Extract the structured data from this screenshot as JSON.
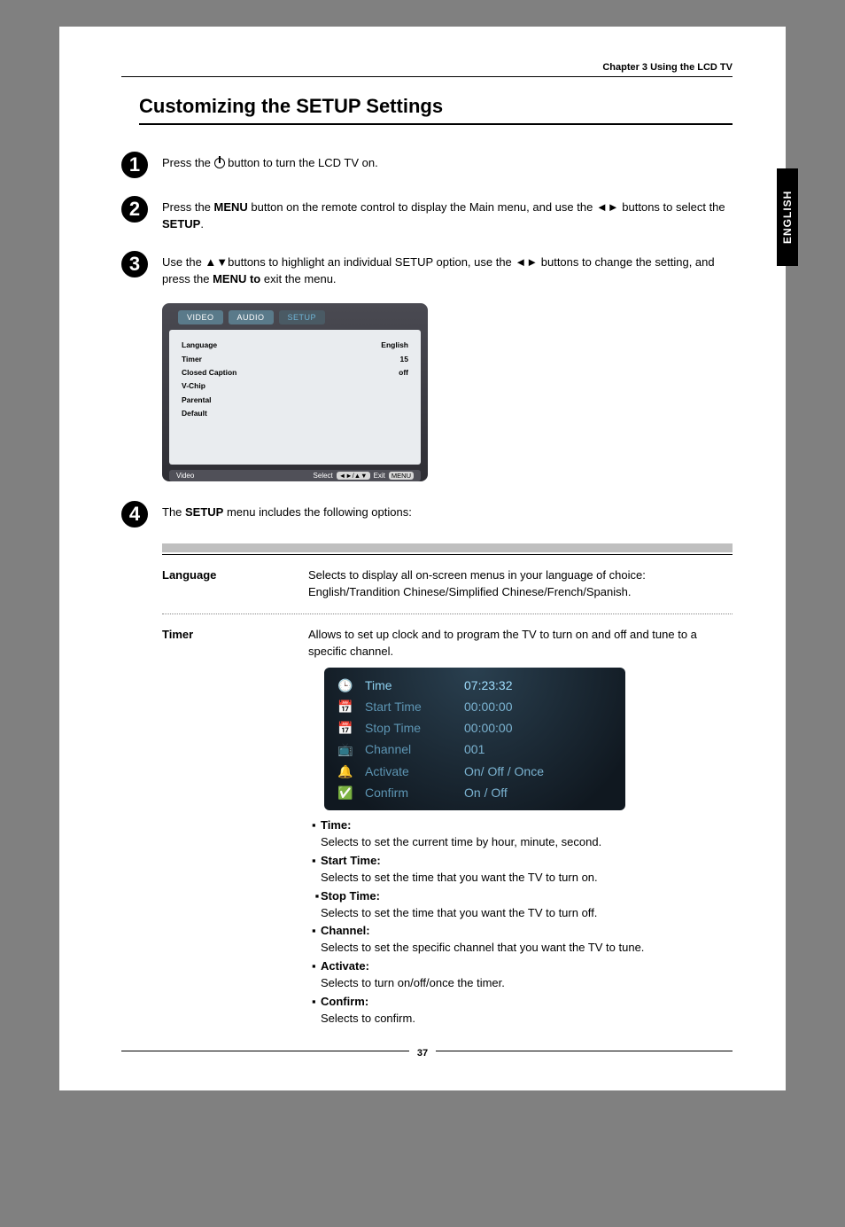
{
  "header": {
    "chapter": "Chapter 3 Using the LCD TV"
  },
  "title": "Customizing the SETUP Settings",
  "side_tab": "ENGLISH",
  "page_number": "37",
  "steps": [
    {
      "num": "1",
      "text_before": "Press the ",
      "icon": "power-icon",
      "text_after": " button to turn the LCD TV on."
    },
    {
      "num": "2",
      "text_before": "Press the ",
      "bold1": "MENU",
      "text_mid": " button on the remote control to display the Main menu, and use the ◄► buttons to select the ",
      "bold2": "SETUP",
      "text_after": "."
    },
    {
      "num": "3",
      "text_before": "Use the ▲▼buttons to highlight an individual SETUP option, use the ◄► buttons to change the setting, and press the ",
      "bold1": "MENU to",
      "text_after": " exit the menu."
    },
    {
      "num": "4",
      "text_before": "The ",
      "bold1": "SETUP",
      "text_after": " menu includes the following options:"
    }
  ],
  "menu": {
    "tabs": {
      "video": "VIDEO",
      "audio": "AUDIO",
      "setup": "SETUP"
    },
    "rows": [
      {
        "label": "Language",
        "value": "English"
      },
      {
        "label": "Timer",
        "value": "15"
      },
      {
        "label": "Closed Caption",
        "value": "off"
      },
      {
        "label": "V-Chip",
        "value": ""
      },
      {
        "label": "Parental",
        "value": ""
      },
      {
        "label": "Default",
        "value": ""
      }
    ],
    "footer_left": "Video",
    "footer_select": "Select",
    "footer_arrows": "◄►/▲▼",
    "footer_exit": "Exit",
    "footer_menu": "MENU"
  },
  "options": {
    "language": {
      "label": "Language",
      "desc": "Selects to display all on-screen menus in your language of choice: English/Trandition Chinese/Simplified Chinese/French/Spanish."
    },
    "timer": {
      "label": "Timer",
      "desc": "Allows to set up clock and to program the TV to turn on and off and tune to a specific channel."
    }
  },
  "timer_menu": {
    "rows": [
      {
        "icon": "🕒",
        "icon_name": "clock-icon",
        "label": "Time",
        "hl": true,
        "value": "07:23:32"
      },
      {
        "icon": "📅",
        "icon_name": "calendar-start-icon",
        "label": "Start  Time",
        "value": "00:00:00"
      },
      {
        "icon": "📅",
        "icon_name": "calendar-stop-icon",
        "label": "Stop  Time",
        "value": "00:00:00"
      },
      {
        "icon": "📺",
        "icon_name": "tv-channel-icon",
        "label": "Channel",
        "value": "001"
      },
      {
        "icon": "🔔",
        "icon_name": "bell-activate-icon",
        "label": "Activate",
        "value": "On/ Off / Once",
        "rich": true
      },
      {
        "icon": "✅",
        "icon_name": "check-confirm-icon",
        "label": "Confirm",
        "value": "On / Off",
        "rich": true
      }
    ]
  },
  "bullets": [
    {
      "label": "Time:",
      "desc": "Selects to set the current time by hour, minute, second."
    },
    {
      "label": "Start Time:",
      "desc": "Selects to set the time that you want the TV to turn on."
    },
    {
      "label": "Stop Time:",
      "desc": "Selects to set the time that you want the TV to turn off."
    },
    {
      "label": "Channel:",
      "desc": "Selects to set the specific channel that you want the TV to tune."
    },
    {
      "label": "Activate:",
      "desc": "Selects to turn on/off/once the timer."
    },
    {
      "label": "Confirm:",
      "desc": "Selects to confirm."
    }
  ]
}
